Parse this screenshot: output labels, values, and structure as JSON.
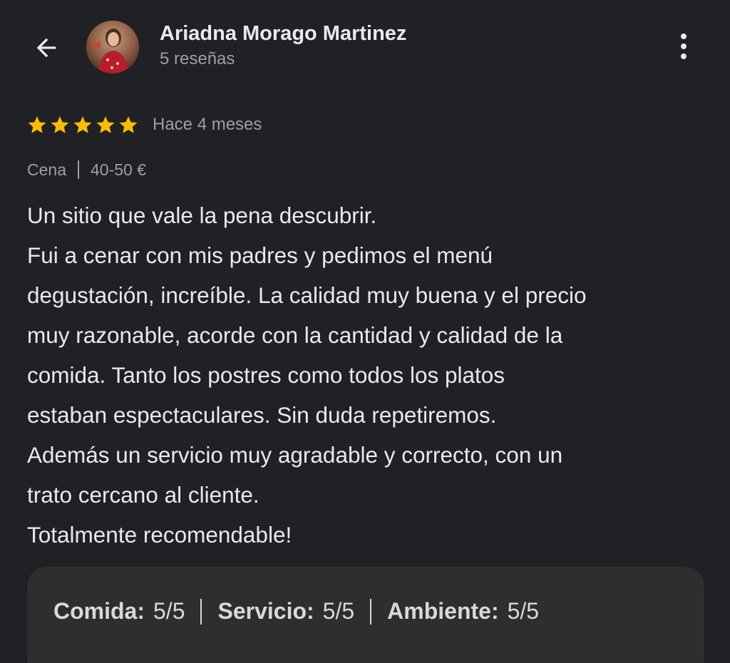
{
  "header": {
    "author_name": "Ariadna Morago Martinez",
    "review_count": "5 reseñas"
  },
  "review": {
    "stars": 5,
    "max_stars": 5,
    "time": "Hace 4 meses",
    "meal": "Cena",
    "price": "40-50 €",
    "lines": [
      "Un sitio que vale la pena descubrir.",
      "Fui a cenar con mis padres y pedimos el menú",
      "degustación, increíble. La calidad muy buena y el precio",
      "muy razonable, acorde con la cantidad y calidad de la",
      "comida. Tanto los postres como todos los platos",
      "estaban espectaculares. Sin duda repetiremos.",
      "Además un servicio muy agradable y correcto, con un",
      "trato cercano al cliente.",
      "Totalmente recomendable!"
    ]
  },
  "ratings": {
    "food_label": "Comida:",
    "food_value": "5/5",
    "service_label": "Servicio:",
    "service_value": "5/5",
    "ambience_label": "Ambiente:",
    "ambience_value": "5/5"
  },
  "icons": {
    "back": "arrow-back-icon",
    "more": "more-vert-icon",
    "star": "star-icon"
  },
  "colors": {
    "background": "#202124",
    "card": "#2d2e30",
    "star": "#fbbc04",
    "text_primary": "#e8eaed",
    "text_secondary": "#9aa0a6"
  }
}
